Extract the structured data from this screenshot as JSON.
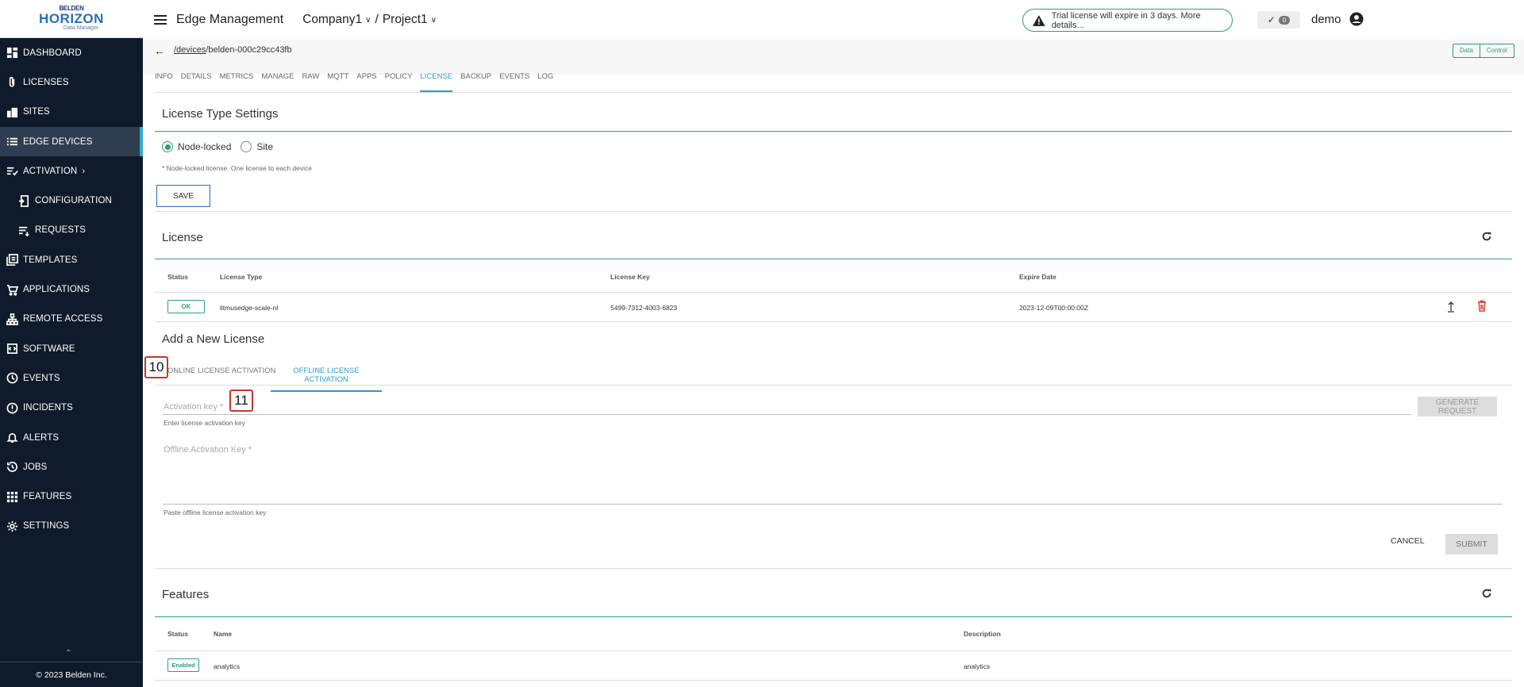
{
  "sidebar": {
    "logo": {
      "top": "BELDEN",
      "main": "HORIZON",
      "sub": "Data Manager"
    },
    "items": [
      {
        "label": "DASHBOARD",
        "icon": "dashboard-icon"
      },
      {
        "label": "LICENSES",
        "icon": "paperclip-icon"
      },
      {
        "label": "SITES",
        "icon": "building-icon"
      },
      {
        "label": "EDGE DEVICES",
        "icon": "list-icon",
        "active": true
      },
      {
        "label": "ACTIVATION",
        "icon": "activation-icon"
      },
      {
        "label": "CONFIGURATION",
        "icon": "configuration-icon"
      },
      {
        "label": "REQUESTS",
        "icon": "requests-icon"
      },
      {
        "label": "TEMPLATES",
        "icon": "templates-icon"
      },
      {
        "label": "APPLICATIONS",
        "icon": "cart-icon"
      },
      {
        "label": "REMOTE ACCESS",
        "icon": "network-icon"
      },
      {
        "label": "SOFTWARE",
        "icon": "software-icon"
      },
      {
        "label": "EVENTS",
        "icon": "clock-icon"
      },
      {
        "label": "INCIDENTS",
        "icon": "alert-circle-icon"
      },
      {
        "label": "ALERTS",
        "icon": "bell-icon"
      },
      {
        "label": "JOBS",
        "icon": "history-icon"
      },
      {
        "label": "FEATURES",
        "icon": "grid-icon"
      },
      {
        "label": "SETTINGS",
        "icon": "gear-icon"
      }
    ],
    "copyright": "© 2023 Belden Inc."
  },
  "header": {
    "app_title": "Edge Management",
    "company": "Company1",
    "separator": "/",
    "project": "Project1",
    "trial_notice": "Trial license will expire in 3 days. More details...",
    "notification_count": "0",
    "user": "demo"
  },
  "subheader": {
    "path_link": "/devices",
    "path_rest": "/belden-000c29cc43fb",
    "toggle": [
      "Data",
      "Control"
    ]
  },
  "tabs": [
    "INFO",
    "DETAILS",
    "METRICS",
    "MANAGE",
    "RAW",
    "MQTT",
    "APPS",
    "POLICY",
    "LICENSE",
    "BACKUP",
    "EVENTS",
    "LOG"
  ],
  "active_tab": "LICENSE",
  "license_type": {
    "title": "License Type Settings",
    "options": [
      "Node-locked",
      "Site"
    ],
    "selected": "Node-locked",
    "note": "* Node-locked license. One license to each device",
    "save_label": "SAVE"
  },
  "license": {
    "title": "License",
    "columns": [
      "Status",
      "License Type",
      "License Key",
      "Expire Date"
    ],
    "row": {
      "status": "OK",
      "type": "litmusedge-scale-nl",
      "key": "5499-7312-4003-6823",
      "expire": "2023-12-09T00:00:00Z"
    }
  },
  "add_license": {
    "title": "Add a New License",
    "tabs": [
      "ONLINE LICENSE ACTIVATION",
      "OFFLINE LICENSE ACTIVATION"
    ],
    "active_tab": "OFFLINE LICENSE ACTIVATION",
    "activation_key_label": "Activation key *",
    "activation_key_hint": "Enter license activation key",
    "generate_label": "GENERATE REQUEST",
    "offline_key_label": "Offline Activation Key *",
    "offline_key_hint": "Paste offline license activation key",
    "cancel_label": "CANCEL",
    "submit_label": "SUBMIT"
  },
  "markers": {
    "m10": "10",
    "m11": "11"
  },
  "features": {
    "title": "Features",
    "columns": [
      "Status",
      "Name",
      "Description"
    ],
    "row": {
      "status": "Enabled",
      "name": "analytics",
      "description": "analytics"
    }
  }
}
